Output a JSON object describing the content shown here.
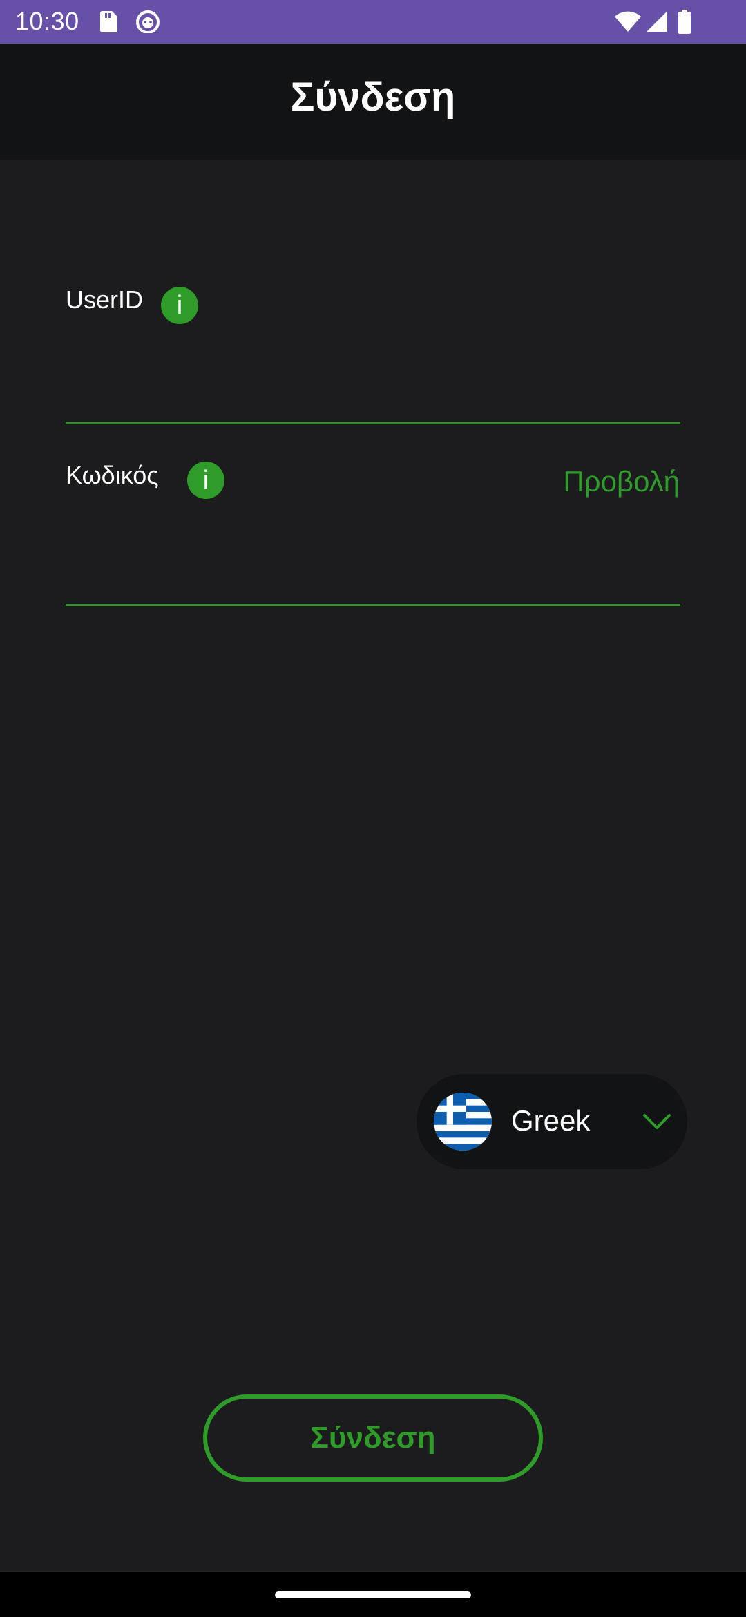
{
  "status_bar": {
    "time": "10:30",
    "icons": [
      "sd-card-icon",
      "cat-icon",
      "wifi-icon",
      "signal-icon",
      "battery-icon"
    ]
  },
  "app_bar": {
    "title": "Σύνδεση"
  },
  "form": {
    "userid_label": "UserID",
    "userid_value": "",
    "password_label": "Κωδικός",
    "password_value": "",
    "show_label": "Προβολή",
    "info_glyph": "i"
  },
  "language": {
    "selected": "Greek",
    "flag": "greece-flag-icon"
  },
  "login_button": {
    "label": "Σύνδεση"
  },
  "colors": {
    "accent": "#2f9c2a",
    "status_bar": "#6751a8",
    "app_bar": "#111315",
    "background": "#1c1c1e"
  }
}
